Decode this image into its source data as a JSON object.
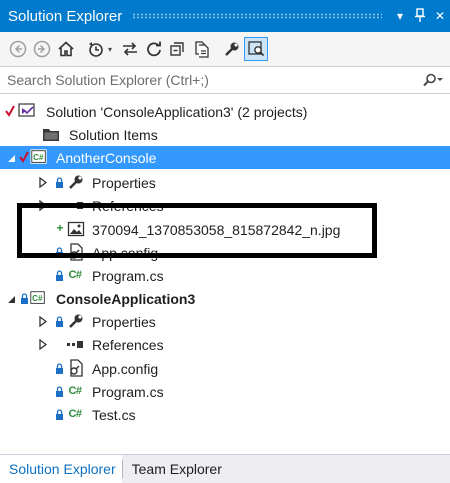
{
  "window": {
    "title": "Solution Explorer",
    "dropdown_glyph": "▾",
    "pin_glyph": "⊣",
    "close_glyph": "✕"
  },
  "toolbar": {
    "buttons": [
      "back-icon",
      "forward-icon",
      "home-icon",
      "pending-changes-filter-icon",
      "sync-icon",
      "refresh-icon",
      "collapse-all-icon",
      "show-all-files-icon",
      "properties-icon",
      "preview-selected-items-icon"
    ]
  },
  "search": {
    "placeholder": "Search Solution Explorer (Ctrl+;)"
  },
  "tree": {
    "solution": "Solution 'ConsoleApplication3' (2 projects)",
    "solution_items": "Solution Items",
    "project1": {
      "name": "AnotherConsole",
      "properties": "Properties",
      "references": "References",
      "image_file": "370094_1370853058_815872842_n.jpg",
      "app_config": "App.config",
      "program": "Program.cs"
    },
    "project2": {
      "name": "ConsoleApplication3",
      "properties": "Properties",
      "references": "References",
      "app_config": "App.config",
      "program": "Program.cs",
      "test": "Test.cs"
    },
    "cs_label": "C#",
    "add_badge": "+"
  },
  "tabs": {
    "solution_explorer": "Solution Explorer",
    "team_explorer": "Team Explorer"
  },
  "colors": {
    "accent": "#007acc",
    "selection": "#3399ff",
    "csharp_green": "#2e8b3a",
    "lock_blue": "#1c6fc4",
    "checkout_red": "#c8102e"
  }
}
